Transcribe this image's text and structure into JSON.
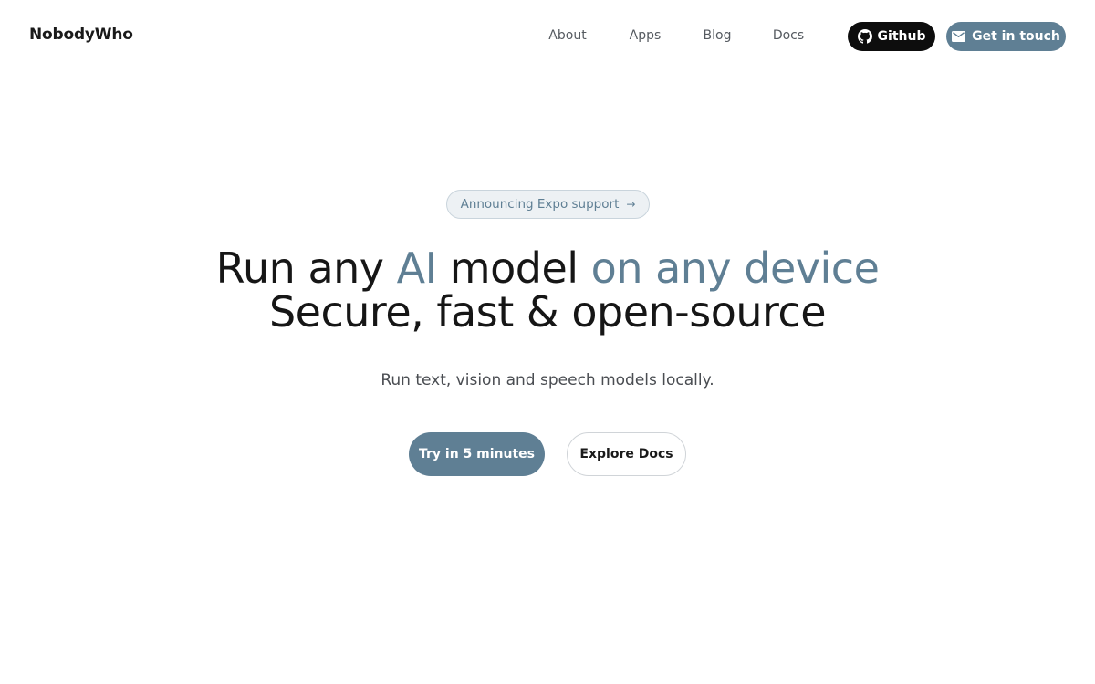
{
  "header": {
    "logo": "NobodyWho",
    "nav": {
      "about": "About",
      "apps": "Apps",
      "blog": "Blog",
      "docs": "Docs"
    },
    "github_button": {
      "label": "Github",
      "icon": "github-icon"
    },
    "contact_button": {
      "label": "Get in touch",
      "icon": "mail-icon"
    }
  },
  "hero": {
    "announcement": {
      "label": "Announcing Expo support",
      "arrow": "→"
    },
    "headline": {
      "line1": {
        "part1": "Run any ",
        "part2": "AI",
        "part3": " model ",
        "part4": "on any device"
      },
      "line2": "Secure, fast & open-source"
    },
    "subtitle": "Run text, vision and speech models locally.",
    "primary_button": "Try in 5 minutes",
    "secondary_button": "Explore Docs"
  },
  "colors": {
    "accent": "#5f7f94",
    "text": "#161616",
    "github_button_bg": "#0d0d0d",
    "announcement_bg": "#edf1f4"
  }
}
